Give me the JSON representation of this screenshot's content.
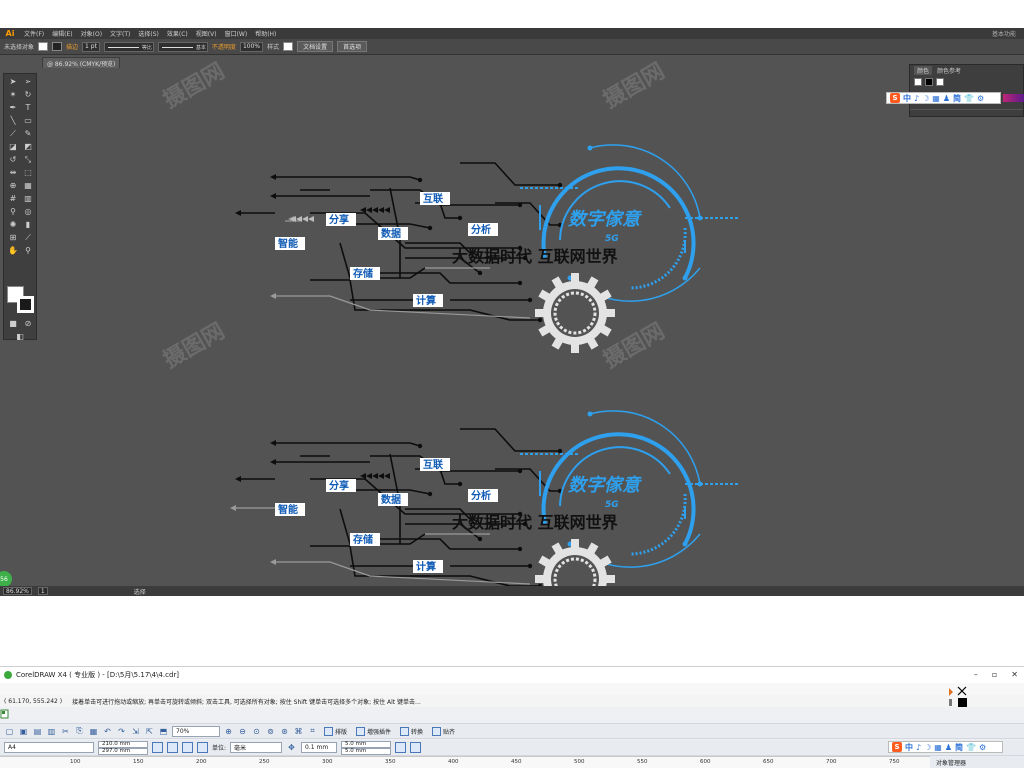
{
  "illustrator": {
    "logo": "Ai",
    "menu": [
      "文件(F)",
      "编辑(E)",
      "对象(O)",
      "文字(T)",
      "选择(S)",
      "效果(C)",
      "视图(V)",
      "窗口(W)",
      "帮助(H)"
    ],
    "workspace": "基本功能",
    "control_bar": {
      "selection_status": "未选择对象",
      "stroke_label": "描边",
      "stroke_weight": "1 pt",
      "profile_label": "等比",
      "brush_label": "基本",
      "opacity_label": "不透明度",
      "opacity_value": "100%",
      "style_label": "样式",
      "doc_setup_button": "文档设置",
      "preferences_button": "首选项"
    },
    "document_tab": "@ 86.92% (CMYK/预览)",
    "panel": {
      "tabs": [
        "颜色",
        "颜色参考"
      ]
    },
    "statusbar": {
      "zoom": "86.92%",
      "page": "1",
      "tool": "选择"
    },
    "badge": "56"
  },
  "artwork": [
    {
      "labels": {
        "l1": "互联",
        "l2": "分享",
        "l3": "分析",
        "l4": "数据",
        "l5": "智能",
        "l6": "存储",
        "l7": "计算"
      },
      "title": "数字傢意",
      "subtitle": "5G",
      "slogan": "大数据时代  互联网世界"
    },
    {
      "labels": {
        "l1": "互联",
        "l2": "分享",
        "l3": "分析",
        "l4": "数据",
        "l5": "智能",
        "l6": "存储",
        "l7": "计算"
      },
      "title": "数字傢意",
      "subtitle": "5G",
      "slogan": "大数据时代  互联网世界"
    }
  ],
  "ime": {
    "items": [
      "中",
      "♪",
      "☽",
      "▦",
      "♟",
      "简",
      "👕",
      "⚙"
    ]
  },
  "coreldraw": {
    "title": "CorelDRAW X4 ( 专业版 ) - [D:\\5月\\5.17\\4\\4.cdr]",
    "coords": "( 61.170, 555.242 )",
    "hint": "接着单击可进行拖动或缩放; 再单击可旋转或倾斜; 双击工具, 可选择所有对象; 按住 Shift 键单击可选择多个对象; 按住 Alt 键单击...",
    "zoom": "70%",
    "buttons": [
      "排版",
      "増强插件",
      "转换",
      "贴齐"
    ],
    "page_size": "A4",
    "width": "210.0 mm",
    "height": "297.0 mm",
    "unit_label": "单位:",
    "unit": "毫米",
    "nudge": "0.1 mm",
    "dup_x": "5.0 mm",
    "dup_y": "5.0 mm",
    "ruler": [
      "100",
      "150",
      "200",
      "250",
      "300",
      "350",
      "400",
      "450",
      "500",
      "550",
      "600",
      "650",
      "700",
      "750",
      "800"
    ],
    "object_manager": "对象管理器"
  }
}
